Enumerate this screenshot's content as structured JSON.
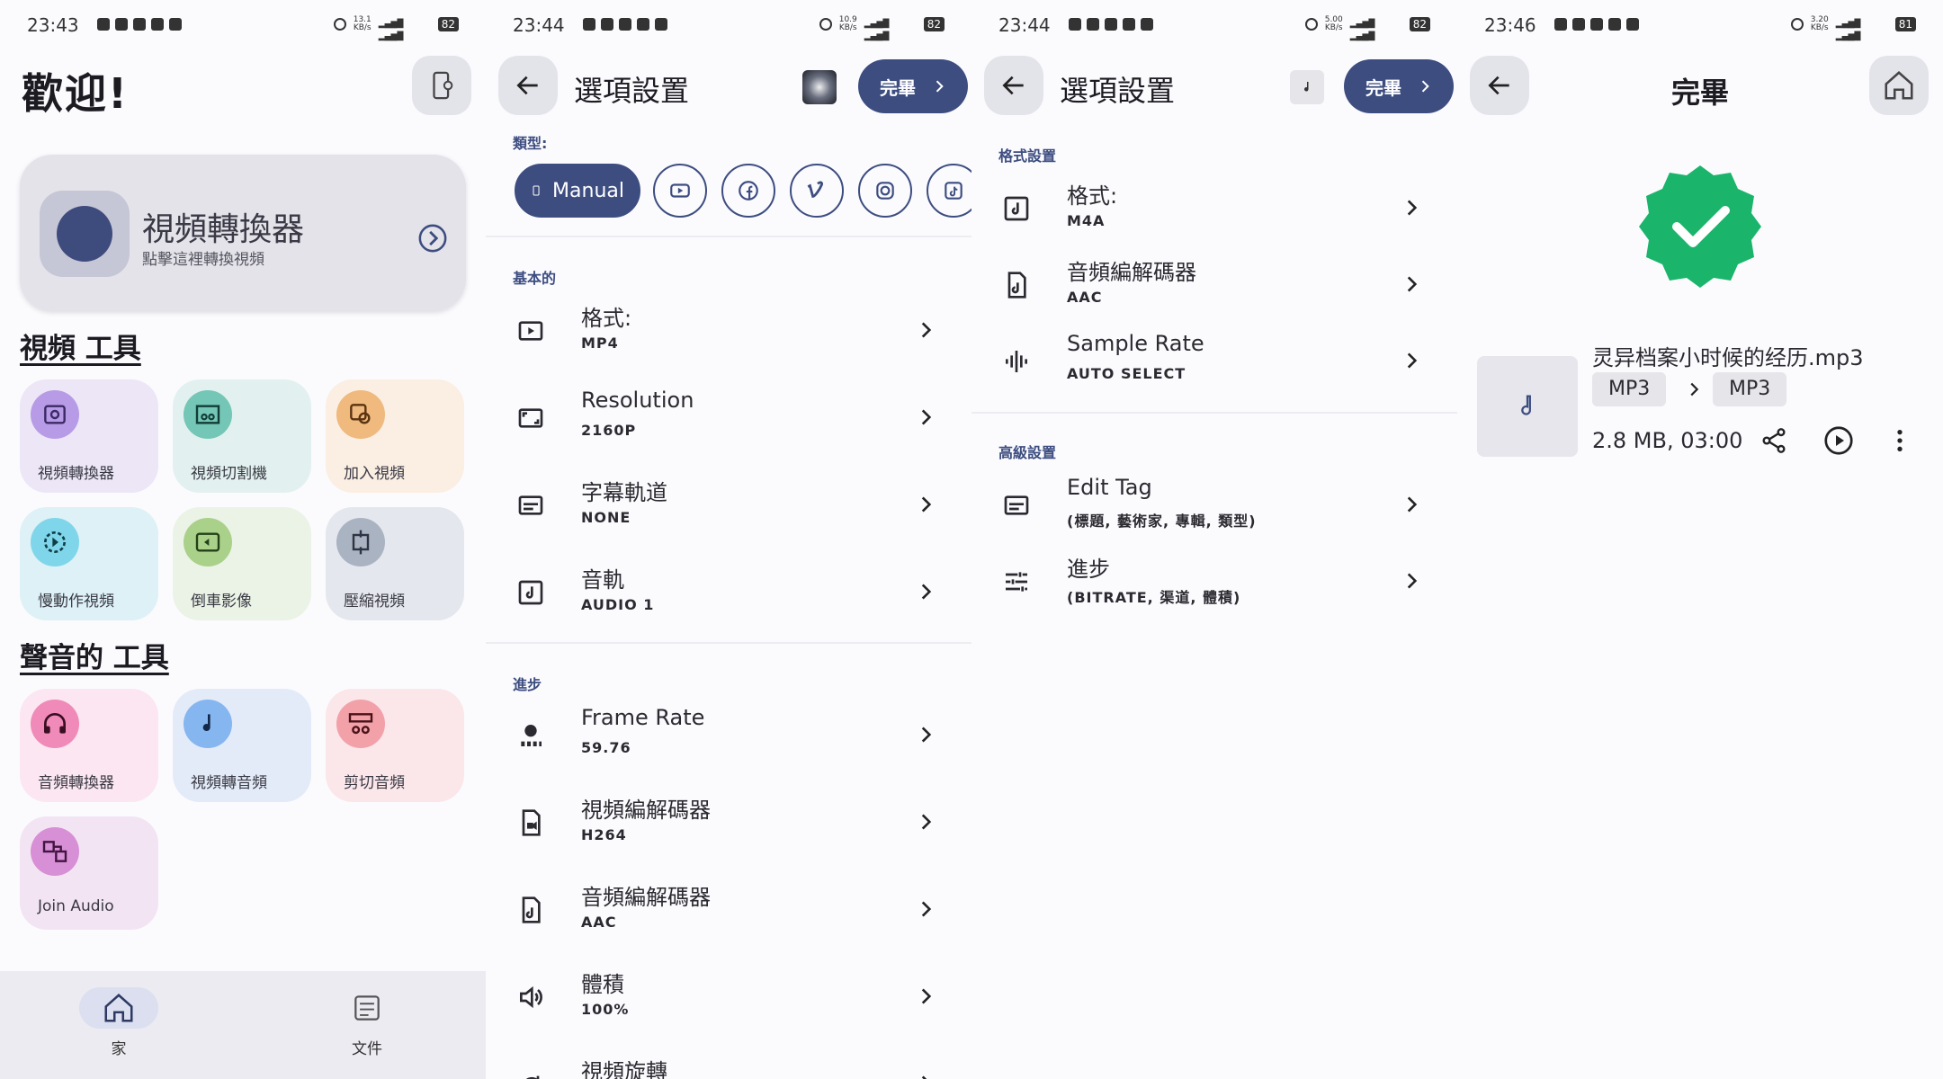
{
  "colors": {
    "primary": "#3d4d80",
    "success": "#1ab56b",
    "surface": "#e3e3ea"
  },
  "status_bars": [
    {
      "time": "23:43",
      "speed": "13.1",
      "speed_unit": "KB/s",
      "battery": "82"
    },
    {
      "time": "23:44",
      "speed": "10.9",
      "speed_unit": "KB/s",
      "battery": "82"
    },
    {
      "time": "23:44",
      "speed": "5.00",
      "speed_unit": "KB/s",
      "battery": "82"
    },
    {
      "time": "23:46",
      "speed": "3.20",
      "speed_unit": "KB/s",
      "battery": "81"
    }
  ],
  "home": {
    "welcome": "歡迎!",
    "hero": {
      "title": "視頻轉換器",
      "subtitle": "點擊這裡轉換視頻"
    },
    "video_section_title": "視頻 工具",
    "video_tools": [
      {
        "label": "視頻轉換器",
        "icon": "video-settings-icon",
        "bg": "#ece6f6",
        "icon_bg": "#b79be6"
      },
      {
        "label": "視頻切割機",
        "icon": "film-cut-icon",
        "bg": "#e2f1ef",
        "icon_bg": "#74c6b6"
      },
      {
        "label": "加入視頻",
        "icon": "merge-video-icon",
        "bg": "#fbeee3",
        "icon_bg": "#f0b97d"
      },
      {
        "label": "慢動作視頻",
        "icon": "slow-motion-icon",
        "bg": "#ddf1f6",
        "icon_bg": "#7fd6ea"
      },
      {
        "label": "倒車影像",
        "icon": "reverse-video-icon",
        "bg": "#ebf3e6",
        "icon_bg": "#a9d18a"
      },
      {
        "label": "壓縮視頻",
        "icon": "compress-video-icon",
        "bg": "#e4e7ed",
        "icon_bg": "#aab3c2"
      }
    ],
    "audio_section_title": "聲音的 工具",
    "audio_tools": [
      {
        "label": "音頻轉換器",
        "icon": "headphones-icon",
        "bg": "#fbe6f1",
        "icon_bg": "#f08ab8"
      },
      {
        "label": "視頻轉音頻",
        "icon": "music-note-icon",
        "bg": "#e3ebf9",
        "icon_bg": "#85b6ef"
      },
      {
        "label": "剪切音頻",
        "icon": "audio-cut-icon",
        "bg": "#fbe6ea",
        "icon_bg": "#f2a1a9"
      },
      {
        "label": "Join Audio",
        "icon": "join-audio-icon",
        "bg": "#f3e4f3",
        "icon_bg": "#d78fd6"
      }
    ],
    "nav": [
      {
        "label": "家",
        "icon": "home-icon"
      },
      {
        "label": "文件",
        "icon": "files-icon"
      }
    ]
  },
  "video_options": {
    "title": "選項設置",
    "done": "完畢",
    "type_label": "類型:",
    "manual_chip": "Manual",
    "basic_label": "基本的",
    "basic_rows": [
      {
        "title": "格式:",
        "value": "MP4",
        "icon": "play-box-icon"
      },
      {
        "title": "Resolution",
        "value": "2160P",
        "icon": "aspect-ratio-icon"
      },
      {
        "title": "字幕軌道",
        "value": "NONE",
        "icon": "subtitles-icon"
      },
      {
        "title": "音軌",
        "value": "AUDIO 1",
        "icon": "music-box-icon"
      }
    ],
    "advanced_label": "進步",
    "advanced_rows": [
      {
        "title": "Frame Rate",
        "value": "59.76",
        "icon": "frame-rate-icon"
      },
      {
        "title": "視頻編解碼器",
        "value": "H264",
        "icon": "video-file-icon"
      },
      {
        "title": "音頻編解碼器",
        "value": "AAC",
        "icon": "audio-file-icon"
      },
      {
        "title": "體積",
        "value": "100%",
        "icon": "volume-icon"
      },
      {
        "title": "視頻旋轉",
        "value": "",
        "icon": "rotate-icon"
      }
    ]
  },
  "audio_options": {
    "title": "選項設置",
    "done": "完畢",
    "format_label": "格式設置",
    "format_rows": [
      {
        "title": "格式:",
        "value": "M4A",
        "icon": "music-box-icon"
      },
      {
        "title": "音頻編解碼器",
        "value": "AAC",
        "icon": "audio-file-icon"
      },
      {
        "title": "Sample Rate",
        "value": "AUTO SELECT",
        "icon": "waveform-icon"
      }
    ],
    "advanced_label": "高級設置",
    "advanced_rows": [
      {
        "title": "Edit Tag",
        "value": "(標題, 藝術家, 專輯, 類型)",
        "icon": "tag-icon"
      },
      {
        "title": "進步",
        "value": "(BITRATE, 渠道, 體積)",
        "icon": "tune-icon"
      }
    ]
  },
  "done_screen": {
    "title": "完畢",
    "file_name": "灵异档案小时候的经历.mp3",
    "from_format": "MP3",
    "to_format": "MP3",
    "size_duration": "2.8 MB, 03:00"
  }
}
